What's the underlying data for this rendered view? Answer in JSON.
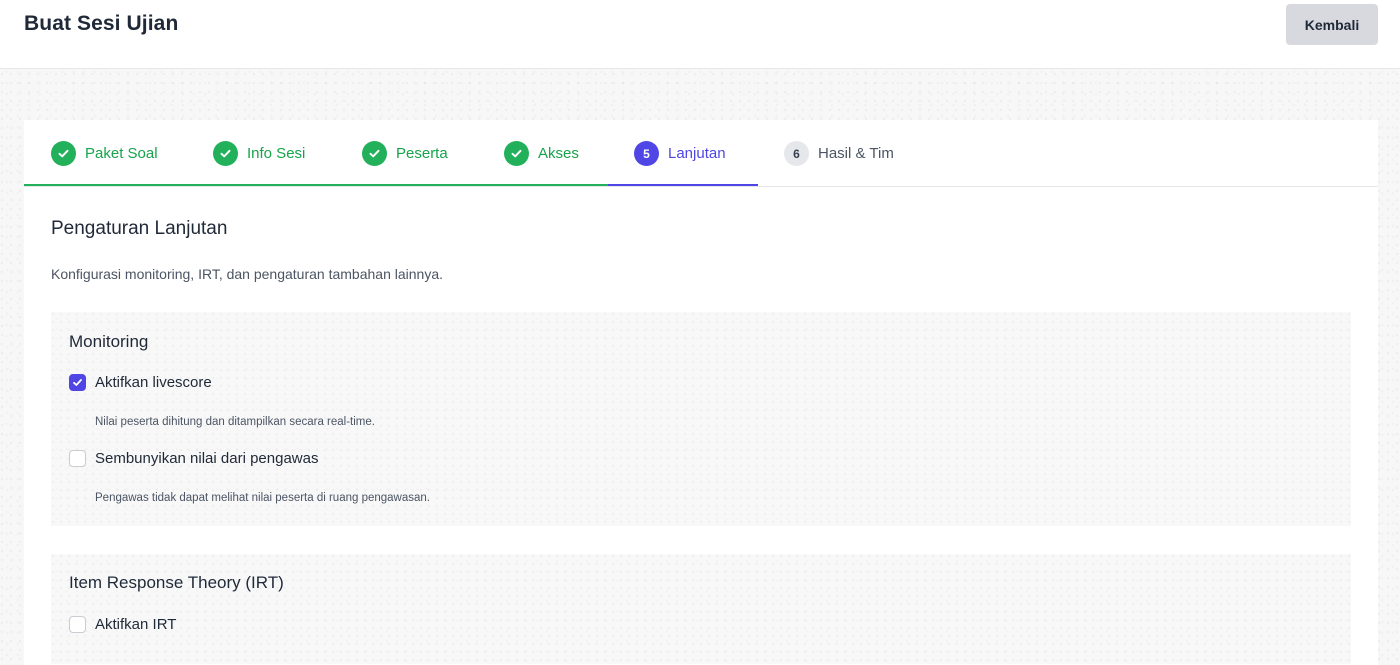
{
  "header": {
    "title": "Buat Sesi Ujian",
    "back_label": "Kembali"
  },
  "steps": [
    {
      "label": "Paket Soal",
      "status": "done"
    },
    {
      "label": "Info Sesi",
      "status": "done"
    },
    {
      "label": "Peserta",
      "status": "done"
    },
    {
      "label": "Akses",
      "status": "done"
    },
    {
      "label": "Lanjutan",
      "status": "active",
      "number": "5"
    },
    {
      "label": "Hasil & Tim",
      "status": "pending",
      "number": "6"
    }
  ],
  "section": {
    "title": "Pengaturan Lanjutan",
    "description": "Konfigurasi monitoring, IRT, dan pengaturan tambahan lainnya."
  },
  "monitoring": {
    "title": "Monitoring",
    "options": [
      {
        "label": "Aktifkan livescore",
        "checked": true,
        "help": "Nilai peserta dihitung dan ditampilkan secara real-time."
      },
      {
        "label": "Sembunyikan nilai dari pengawas",
        "checked": false,
        "help": "Pengawas tidak dapat melihat nilai peserta di ruang pengawasan."
      }
    ]
  },
  "irt": {
    "title": "Item Response Theory (IRT)",
    "options": [
      {
        "label": "Aktifkan IRT",
        "checked": false
      }
    ]
  },
  "colors": {
    "done": "#22b05a",
    "active": "#4f46e5",
    "pending": "#e5e7eb"
  }
}
